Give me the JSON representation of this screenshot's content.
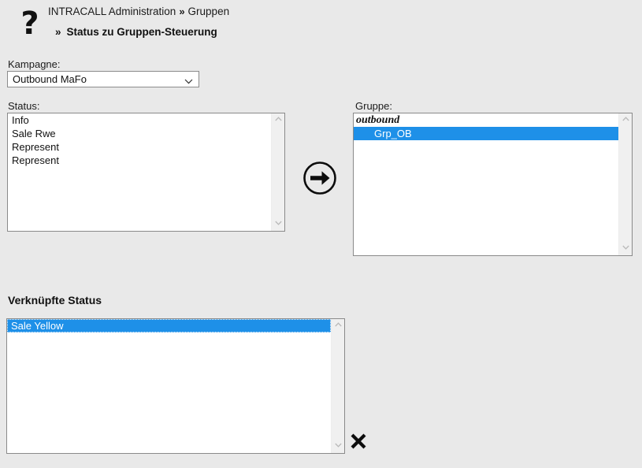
{
  "header": {
    "help_icon": "?",
    "breadcrumb": {
      "root": "INTRACALL Administration",
      "separator": "»",
      "current": "Gruppen"
    },
    "subtitle_separator": "»",
    "subtitle": "Status zu Gruppen-Steuerung"
  },
  "kampagne": {
    "label": "Kampagne:",
    "value": "Outbound MaFo",
    "arrow_icon": "chevron-down-icon"
  },
  "status_panel": {
    "label": "Status:",
    "items": [
      {
        "text": "Info",
        "selected": false,
        "group": false
      },
      {
        "text": "Sale Rwe",
        "selected": false,
        "group": false
      },
      {
        "text": "Represent",
        "selected": false,
        "group": false
      },
      {
        "text": "Represent",
        "selected": false,
        "group": false
      }
    ]
  },
  "transfer": {
    "icon": "arrow-right-circle-icon",
    "title": "Zuordnen"
  },
  "gruppe_panel": {
    "label": "Gruppe:",
    "items": [
      {
        "text": "outbound",
        "selected": false,
        "group": true
      },
      {
        "text": "Grp_OB",
        "selected": true,
        "group": false
      }
    ]
  },
  "verknuepfte_panel": {
    "title": "Verknüpfte Status",
    "items": [
      {
        "text": "Sale Yellow",
        "selected": true,
        "focused": true,
        "group": false
      }
    ]
  },
  "delete": {
    "icon": "close-x-icon",
    "title": "Entfernen"
  },
  "colors": {
    "background": "#e9e9e9",
    "selection": "#1e90e8",
    "border": "#8a8a8a",
    "field_background": "#ffffff",
    "text": "#111111",
    "scrollbar_track": "#f0f0f0"
  },
  "scrollbar": {
    "up_icon": "chevron-up-icon",
    "down_icon": "chevron-down-icon"
  }
}
